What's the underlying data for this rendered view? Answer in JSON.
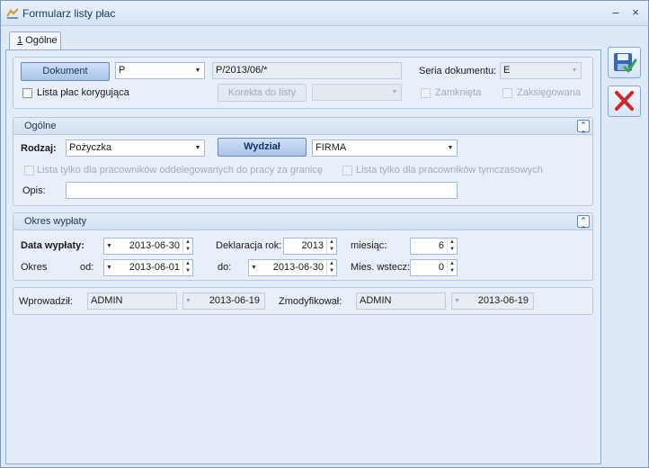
{
  "window": {
    "title": "Formularz listy płac",
    "minimize": "–",
    "close": "×"
  },
  "tab": {
    "accel": "1",
    "label": "Ogólne"
  },
  "header": {
    "dokument_button": "Dokument",
    "dokument_prefix": "P",
    "dokument_number": "P/2013/06/*",
    "seria_label": "Seria dokumentu:",
    "seria_value": "E",
    "korygujaca_label": "Lista płac korygująca",
    "korekta_button": "Korekta do listy",
    "korekta_value": "",
    "zamknieta_label": "Zamknięta",
    "zaksiegowana_label": "Zaksięgowana"
  },
  "ogolne": {
    "title": "Ogólne",
    "rodzaj_label": "Rodzaj:",
    "rodzaj_value": "Pożyczka",
    "wydzial_button": "Wydział",
    "wydzial_value": "FIRMA",
    "oddelegowanych_label": "Lista tylko dla pracowników oddelegowanych do pracy za granicę",
    "tymczasowych_label": "Lista tylko dla pracowników tymczasowych",
    "opis_label": "Opis:",
    "opis_value": ""
  },
  "okres": {
    "title": "Okres wypłaty",
    "data_wyplaty_label": "Data wypłaty:",
    "data_wyplaty_value": "2013-06-30",
    "deklaracja_label": "Deklaracja rok:",
    "deklaracja_value": "2013",
    "miesiac_label": "miesiąc:",
    "miesiac_value": "6",
    "okres_label": "Okres",
    "od_label": "od:",
    "od_value": "2013-06-01",
    "do_label": "do:",
    "do_value": "2013-06-30",
    "mies_wstecz_label": "Mies. wstecz:",
    "mies_wstecz_value": "0"
  },
  "footer": {
    "wprowadzil_label": "Wprowadził:",
    "wprowadzil_user": "ADMIN",
    "wprowadzil_date": "2013-06-19",
    "zmodyfikowal_label": "Zmodyfikował:",
    "zmodyfikowal_user": "ADMIN",
    "zmodyfikowal_date": "2013-06-19"
  },
  "icons": {
    "save": "save-icon",
    "cancel": "cancel-icon",
    "collapse": "collapse-up-icon",
    "dropdown": "chevron-down-icon"
  },
  "colors": {
    "accent": "#3569b5",
    "cancel_red": "#d0272b",
    "save_check": "#3aa845"
  }
}
